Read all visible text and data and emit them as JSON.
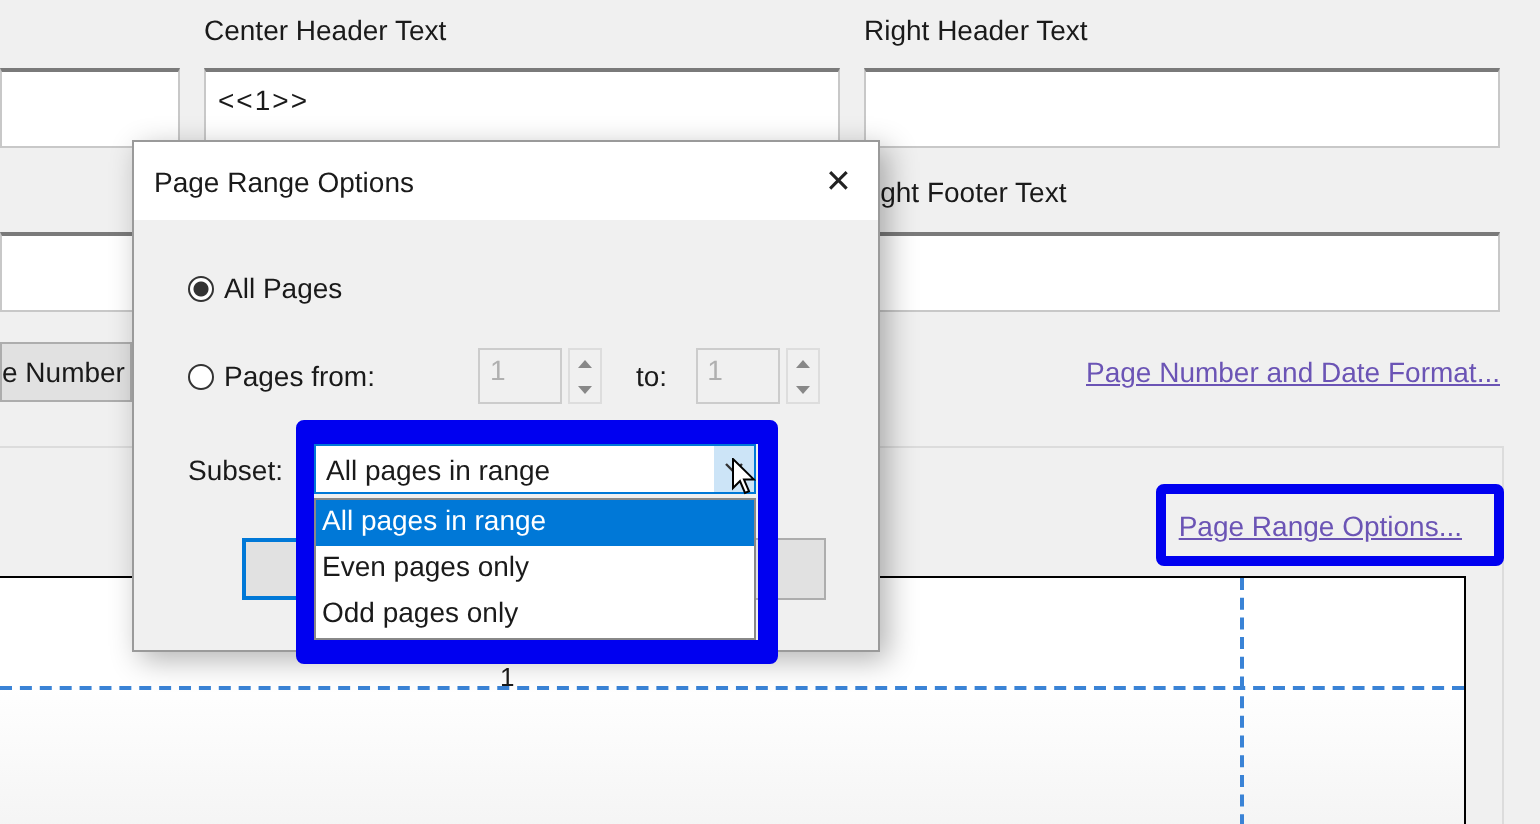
{
  "background": {
    "header_labels": [
      {
        "label": "Center Header Text"
      },
      {
        "label": "Right Header Text"
      }
    ],
    "center_header_value": "<<1>>",
    "footer_label": "ight Footer Text",
    "cut_button": "e Number",
    "format_link": "Page Number and Date Format...",
    "range_link": "Page Range Options...",
    "preview_page_number": "1"
  },
  "dialog": {
    "title": "Page Range Options",
    "close": "✕",
    "radio_options": [
      {
        "label": "All Pages",
        "selected": true
      },
      {
        "label": "Pages from:",
        "selected": false
      }
    ],
    "from": {
      "value": "1",
      "disabled": true
    },
    "to_label": "to:",
    "to": {
      "value": "1",
      "disabled": true
    },
    "subset_label": "Subset:",
    "subset": {
      "value": "All pages in range",
      "expanded": true,
      "options": [
        {
          "label": "All pages in range",
          "selected": true
        },
        {
          "label": "Even pages only",
          "selected": false
        },
        {
          "label": "Odd pages only",
          "selected": false
        }
      ]
    }
  }
}
